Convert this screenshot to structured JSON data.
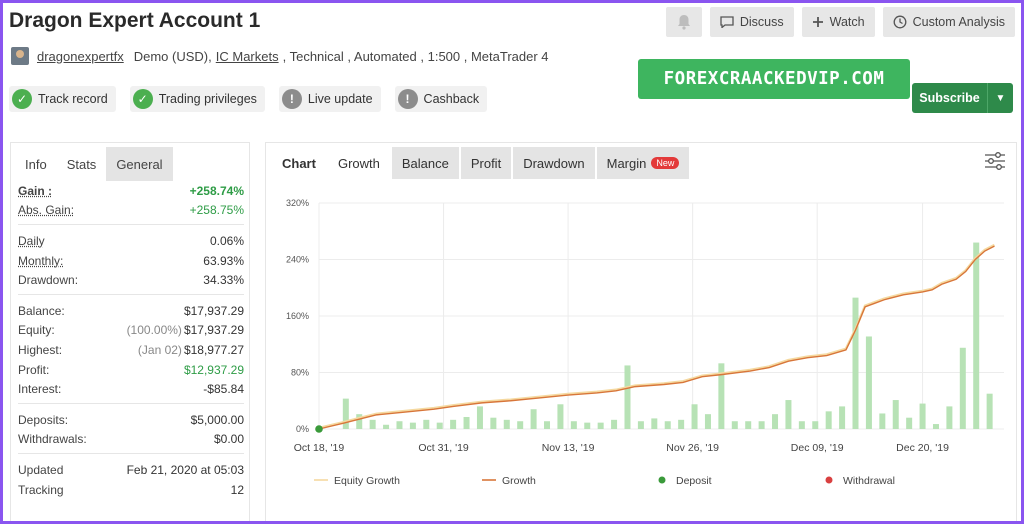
{
  "title": "Dragon Expert Account 1",
  "top_buttons": {
    "discuss": "Discuss",
    "watch": "Watch",
    "custom_analysis": "Custom Analysis"
  },
  "info": {
    "user": "dragonexpertfx",
    "account_type": "Demo (USD),",
    "broker": "IC Markets",
    "details": ", Technical , Automated , 1:500 , MetaTrader 4"
  },
  "badges": [
    "Track record",
    "Trading privileges",
    "Live update",
    "Cashback"
  ],
  "watermark": "FOREXCRAACKEDVIP.COM",
  "subscribe_label": "Subscribe",
  "left_tabs": [
    "Info",
    "Stats",
    "General"
  ],
  "stats": {
    "gain": {
      "label": "Gain :",
      "value": "+258.74%"
    },
    "abs_gain": {
      "label": "Abs. Gain:",
      "value": "+258.75%"
    },
    "daily": {
      "label": "Daily",
      "value": "0.06%"
    },
    "monthly": {
      "label": "Monthly:",
      "value": "63.93%"
    },
    "drawdown": {
      "label": "Drawdown:",
      "value": "34.33%"
    },
    "balance": {
      "label": "Balance:",
      "value": "$17,937.29"
    },
    "equity": {
      "label": "Equity:",
      "sub": "(100.00%)",
      "value": "$17,937.29"
    },
    "highest": {
      "label": "Highest:",
      "sub": "(Jan 02)",
      "value": "$18,977.27"
    },
    "profit": {
      "label": "Profit:",
      "value": "$12,937.29"
    },
    "interest": {
      "label": "Interest:",
      "value": "-$85.84"
    },
    "deposits": {
      "label": "Deposits:",
      "value": "$5,000.00"
    },
    "withdrawals": {
      "label": "Withdrawals:",
      "value": "$0.00"
    },
    "updated": {
      "label": "Updated",
      "value": "Feb 21, 2020 at 05:03"
    },
    "tracking": {
      "label": "Tracking",
      "value": "12"
    }
  },
  "chart_tabs": {
    "chart": "Chart",
    "growth": "Growth",
    "balance": "Balance",
    "profit": "Profit",
    "drawdown": "Drawdown",
    "margin": "Margin",
    "new_badge": "New"
  },
  "colors": {
    "growth": "#d8763a",
    "equity": "#f5d9a0",
    "bars": "#b7e2b5",
    "deposit": "#3a9a3a",
    "withdrawal": "#d94040"
  },
  "chart_data": {
    "type": "bar+line",
    "ytick_labels": [
      "0%",
      "80%",
      "160%",
      "240%",
      "320%"
    ],
    "ylim": [
      0,
      320
    ],
    "xtick_labels": [
      "Oct 18, '19",
      "Oct 31, '19",
      "Nov 13, '19",
      "Nov 26, '19",
      "Dec 09, '19",
      "Dec 20, '19"
    ],
    "x_days": [
      0,
      13,
      26,
      39,
      52,
      63
    ],
    "legend": [
      "Equity Growth",
      "Growth",
      "Deposit",
      "Withdrawal"
    ],
    "legend_position": "bottom",
    "grid": true,
    "bars": [
      {
        "d": 2.8,
        "v": 43
      },
      {
        "d": 4.2,
        "v": 21
      },
      {
        "d": 5.6,
        "v": 13
      },
      {
        "d": 7.0,
        "v": 6
      },
      {
        "d": 8.4,
        "v": 11
      },
      {
        "d": 9.8,
        "v": 9
      },
      {
        "d": 11.2,
        "v": 13
      },
      {
        "d": 12.6,
        "v": 9
      },
      {
        "d": 14.0,
        "v": 13
      },
      {
        "d": 15.4,
        "v": 17
      },
      {
        "d": 16.8,
        "v": 32
      },
      {
        "d": 18.2,
        "v": 16
      },
      {
        "d": 19.6,
        "v": 13
      },
      {
        "d": 21.0,
        "v": 11
      },
      {
        "d": 22.4,
        "v": 28
      },
      {
        "d": 23.8,
        "v": 11
      },
      {
        "d": 25.2,
        "v": 35
      },
      {
        "d": 26.6,
        "v": 11
      },
      {
        "d": 28.0,
        "v": 9
      },
      {
        "d": 29.4,
        "v": 9
      },
      {
        "d": 30.8,
        "v": 13
      },
      {
        "d": 32.2,
        "v": 90
      },
      {
        "d": 33.6,
        "v": 11
      },
      {
        "d": 35.0,
        "v": 15
      },
      {
        "d": 36.4,
        "v": 11
      },
      {
        "d": 37.8,
        "v": 13
      },
      {
        "d": 39.2,
        "v": 35
      },
      {
        "d": 40.6,
        "v": 21
      },
      {
        "d": 42.0,
        "v": 93
      },
      {
        "d": 43.4,
        "v": 11
      },
      {
        "d": 44.8,
        "v": 11
      },
      {
        "d": 46.2,
        "v": 11
      },
      {
        "d": 47.6,
        "v": 21
      },
      {
        "d": 49.0,
        "v": 41
      },
      {
        "d": 50.4,
        "v": 11
      },
      {
        "d": 51.8,
        "v": 11
      },
      {
        "d": 53.2,
        "v": 25
      },
      {
        "d": 54.6,
        "v": 32
      },
      {
        "d": 56.0,
        "v": 186
      },
      {
        "d": 57.4,
        "v": 131
      },
      {
        "d": 58.8,
        "v": 22
      },
      {
        "d": 60.2,
        "v": 41
      },
      {
        "d": 61.6,
        "v": 16
      },
      {
        "d": 63.0,
        "v": 36
      },
      {
        "d": 64.4,
        "v": 7
      },
      {
        "d": 65.8,
        "v": 32
      },
      {
        "d": 67.2,
        "v": 115
      },
      {
        "d": 68.6,
        "v": 264
      },
      {
        "d": 70.0,
        "v": 50
      }
    ],
    "growth_line": [
      [
        0,
        0
      ],
      [
        2.5,
        8
      ],
      [
        4.5,
        15
      ],
      [
        6,
        20
      ],
      [
        9,
        24
      ],
      [
        12,
        28
      ],
      [
        14,
        32
      ],
      [
        17,
        37
      ],
      [
        20,
        40
      ],
      [
        23,
        44
      ],
      [
        26,
        48
      ],
      [
        29,
        51
      ],
      [
        31,
        54
      ],
      [
        33,
        60
      ],
      [
        36,
        63
      ],
      [
        38,
        66
      ],
      [
        40,
        74
      ],
      [
        42,
        77
      ],
      [
        45,
        82
      ],
      [
        47,
        87
      ],
      [
        49,
        96
      ],
      [
        51,
        101
      ],
      [
        53,
        104
      ],
      [
        55,
        112
      ],
      [
        56,
        140
      ],
      [
        57,
        173
      ],
      [
        58,
        178
      ],
      [
        59,
        183
      ],
      [
        61,
        190
      ],
      [
        63,
        194
      ],
      [
        64,
        197
      ],
      [
        65,
        205
      ],
      [
        66.5,
        212
      ],
      [
        67.5,
        223
      ],
      [
        68.5,
        240
      ],
      [
        69.5,
        252
      ],
      [
        70.5,
        259
      ]
    ],
    "deposit_points": [
      [
        0,
        0
      ]
    ]
  }
}
